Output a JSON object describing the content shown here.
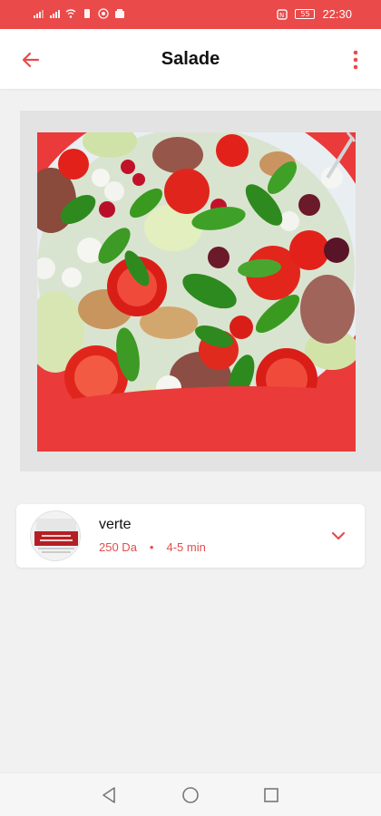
{
  "status_bar": {
    "time": "22:30",
    "battery": "55"
  },
  "header": {
    "title": "Salade",
    "back_icon": "arrow-left-icon",
    "menu_icon": "more-vertical-icon"
  },
  "item": {
    "name": "verte",
    "price": "250 Da",
    "separator": "•",
    "duration": "4-5 min",
    "expand_icon": "chevron-down-icon"
  },
  "nav": {
    "back_icon": "triangle-back-icon",
    "home_icon": "circle-home-icon",
    "recents_icon": "square-recents-icon"
  },
  "colors": {
    "accent": "#ea4a4a",
    "meta_text": "#e24d4d"
  }
}
